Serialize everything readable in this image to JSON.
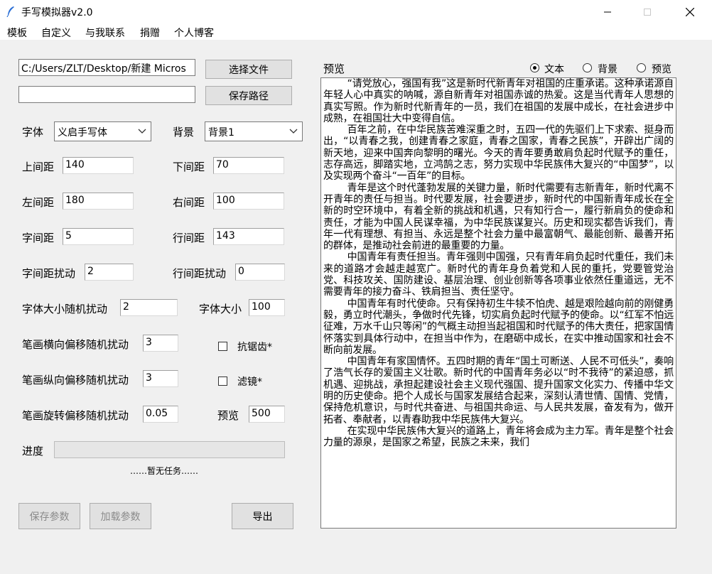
{
  "window": {
    "title": "手写模拟器v2.0"
  },
  "menu": [
    "模板",
    "自定义",
    "与我联系",
    "捐赠",
    "个人博客"
  ],
  "file": {
    "path_value": "C:/Users/ZLT/Desktop/新建 Micros",
    "save_value": "",
    "choose_button": "选择文件",
    "save_button": "保存路径"
  },
  "font": {
    "label": "字体",
    "selected": "义启手写体"
  },
  "background": {
    "label": "背景",
    "selected": "背景1"
  },
  "params": {
    "top_margin": {
      "label": "上间距",
      "value": "140"
    },
    "bottom_margin": {
      "label": "下间距",
      "value": "70"
    },
    "left_margin": {
      "label": "左间距",
      "value": "180"
    },
    "right_margin": {
      "label": "右间距",
      "value": "100"
    },
    "char_spacing": {
      "label": "字间距",
      "value": "5"
    },
    "line_spacing": {
      "label": "行间距",
      "value": "143"
    },
    "char_spacing_jitter": {
      "label": "字间距扰动",
      "value": "2"
    },
    "line_spacing_jitter": {
      "label": "行间距扰动",
      "value": "0"
    },
    "font_size_jitter": {
      "label": "字体大小随机扰动",
      "value": "2"
    },
    "font_size": {
      "label": "字体大小",
      "value": "100"
    },
    "stroke_x_jitter": {
      "label": "笔画横向偏移随机扰动",
      "value": "3"
    },
    "stroke_y_jitter": {
      "label": "笔画纵向偏移随机扰动",
      "value": "3"
    },
    "stroke_rot_jitter": {
      "label": "笔画旋转偏移随机扰动",
      "value": "0.05"
    },
    "preview": {
      "label": "预览",
      "value": "500"
    }
  },
  "options": {
    "antialias": "抗锯齿*",
    "filter": "滤镜*"
  },
  "progress": {
    "label": "进度",
    "value": 0,
    "status": "……暂无任务……"
  },
  "buttons": {
    "save_params": "保存参数",
    "load_params": "加载参数",
    "export": "导出"
  },
  "preview_panel": {
    "label": "预览",
    "modes": [
      "文本",
      "背景",
      "预览"
    ],
    "selected_mode": "文本",
    "paragraphs": [
      "“请党放心，强国有我”这是新时代新青年对祖国的庄重承诺。这种承诺源自年轻人心中真实的呐喊，源自新青年对祖国赤诚的热爱。这是当代青年人思想的真实写照。作为新时代新青年的一员，我们在祖国的发展中成长，在社会进步中成熟，在祖国壮大中变得自信。",
      "百年之前，在中华民族苦难深重之时，五四一代的先驱们上下求索、挺身而出，“以青春之我，创建青春之家庭，青春之国家，青春之民族”，开辟出广阔的新天地，迎来中国奔向黎明的曙光。今天的青年要勇敢肩负起时代赋予的重任，志存高远，脚踏实地，立鸿鹄之志，努力实现中华民族伟大复兴的“中国梦”，以及实现两个奋斗“一百年”的目标。",
      "青年是这个时代蓬勃发展的关键力量，新时代需要有志新青年，新时代离不开青年的责任与担当。时代要发展，社会要进步，新时代的中国新青年成长在全新的时空环境中，有着全新的挑战和机遇，只有知行合一，履行新肩负的使命和责任，才能为中国人民谋幸福，为中华民族谋复兴。历史和现实都告诉我们，青年一代有理想、有担当、永远是整个社会力量中最富朝气、最能创新、最善开拓的群体，是推动社会前进的最重要的力量。",
      "中国青年有责任担当。青年强则中国强，只有青年肩负起时代重任，我们未来的道路才会越走越宽广。新时代的青年身负着党和人民的重托，党要管党治党、科技攻关、国防建设、基层治理、创业创新等各项事业依然任重道远，无不需要青年的接力奋斗、铁肩担当、责任坚守。",
      "中国青年有时代使命。只有保持初生牛犊不怕虎、越是艰险越向前的刚健勇毅，勇立时代潮头，争做时代先锋，切实肩负起时代赋予的使命。以“红军不怕远征难，万水千山只等闲”的气概主动担当起祖国和时代赋予的伟大责任，把家国情怀落实到具体行动中，在担当中作为，在磨砺中成长，在实中推动国家和社会不断向前发展。",
      "中国青年有家国情怀。五四时期的青年“国土可断送、人民不可低头”，奏响了浩气长存的爱国主义壮歌。新时代的中国青年务必以“时不我待”的紧迫感，抓机遇、迎挑战，承担起建设社会主义现代强国、提升国家文化实力、传播中华文明的历史使命。把个人成长与国家发展结合起来，深刻认清世情、国情、党情，保持危机意识，与时代共奋进、与祖国共命运、与人民共发展，奋发有为，做开拓者、奉献者，以青春助我中华民族伟大复兴。",
      "在实现中华民族伟大复兴的道路上，青年将会成为主力军。青年是整个社会力量的源泉，是国家之希望，民族之未来，我们"
    ]
  }
}
